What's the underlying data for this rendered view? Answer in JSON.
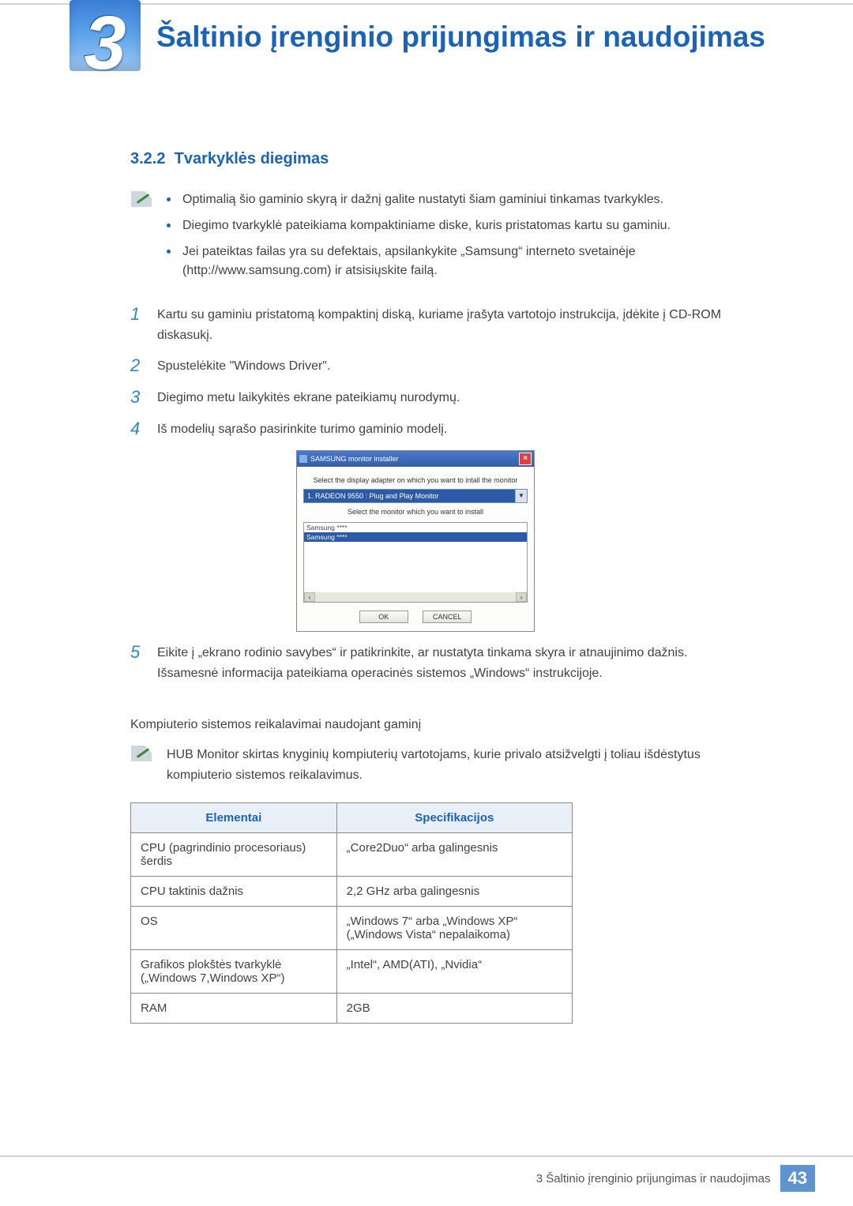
{
  "chapter": {
    "number": "3",
    "title": "Šaltinio įrenginio prijungimas ir naudojimas"
  },
  "section": {
    "number": "3.2.2",
    "title": "Tvarkyklės diegimas"
  },
  "intro_bullets": [
    "Optimalią šio gaminio skyrą ir dažnį galite nustatyti šiam gaminiui tinkamas tvarkykles.",
    "Diegimo tvarkyklė pateikiama kompaktiniame diske, kuris pristatomas kartu su gaminiu.",
    "Jei pateiktas failas yra su defektais, apsilankykite „Samsung“ interneto svetainėje (http://www.samsung.com) ir atsisiųskite failą."
  ],
  "steps": [
    "Kartu su gaminiu pristatomą kompaktinį diską, kuriame įrašyta vartotojo instrukcija, įdėkite į CD-ROM diskasukį.",
    "Spustelėkite \"Windows Driver\".",
    "Diegimo metu laikykitės ekrane pateikiamų nurodymų.",
    "Iš modelių sąrašo pasirinkite turimo gaminio modelį."
  ],
  "installer": {
    "window_title": "SAMSUNG monitor installer",
    "label_adapter": "Select the display adapter on which you want to intall the monitor",
    "adapter_value": "1. RADEON 9550 : Plug and Play Monitor",
    "label_monitor": "Select the monitor which you want to install",
    "list": [
      "Samsung ****",
      "Samsung ****"
    ],
    "ok": "OK",
    "cancel": "CANCEL"
  },
  "step5": "Eikite į „ekrano rodinio savybes“ ir patikrinkite, ar nustatyta tinkama skyra ir atnaujinimo dažnis. Išsamesnė informacija pateikiama operacinės sistemos „Windows“ instrukcijoje.",
  "requirements_intro": "Kompiuterio sistemos reikalavimai naudojant gaminį",
  "requirements_note": "HUB Monitor skirtas knyginių kompiuterių vartotojams, kurie privalo atsižvelgti į toliau išdėstytus kompiuterio sistemos reikalavimus.",
  "table": {
    "headers": [
      "Elementai",
      "Specifikacijos"
    ],
    "rows": [
      [
        "CPU (pagrindinio procesoriaus) šerdis",
        "„Core2Duo“ arba galingesnis"
      ],
      [
        "CPU taktinis dažnis",
        "2,2 GHz arba galingesnis"
      ],
      [
        "OS",
        "„Windows 7“ arba „Windows XP“ („Windows Vista“ nepalaikoma)"
      ],
      [
        "Grafikos plokštės tvarkyklė („Windows 7,Windows XP“)",
        "„Intel“, AMD(ATI), „Nvidia“"
      ],
      [
        "RAM",
        "2GB"
      ]
    ]
  },
  "footer": {
    "crumb": "3 Šaltinio įrenginio prijungimas ir naudojimas",
    "page": "43"
  }
}
